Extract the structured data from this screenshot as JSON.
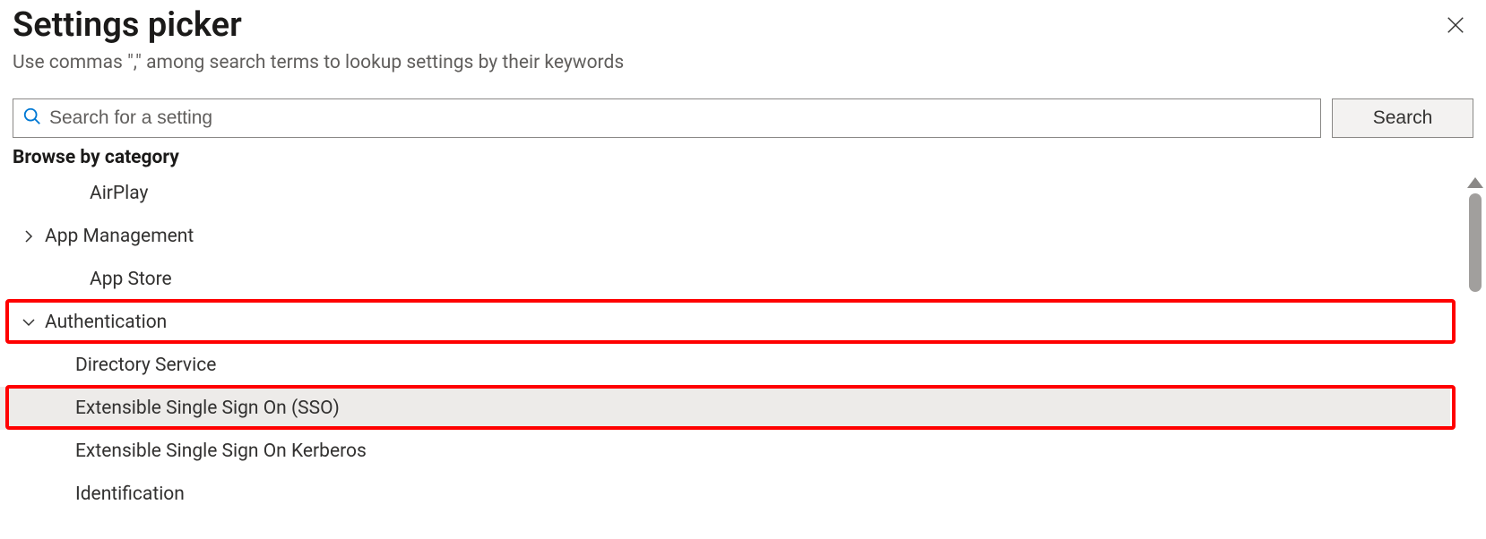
{
  "header": {
    "title": "Settings picker",
    "subtitle": "Use commas \",\" among search terms to lookup settings by their keywords"
  },
  "search": {
    "placeholder": "Search for a setting",
    "value": "",
    "button_label": "Search"
  },
  "browse_label": "Browse by category",
  "categories": [
    {
      "label": "AirPlay",
      "expandable": false,
      "expanded": false,
      "depth": 0,
      "selected": false,
      "highlighted": false
    },
    {
      "label": "App Management",
      "expandable": true,
      "expanded": false,
      "depth": 0,
      "selected": false,
      "highlighted": false
    },
    {
      "label": "App Store",
      "expandable": false,
      "expanded": false,
      "depth": 0,
      "selected": false,
      "highlighted": false
    },
    {
      "label": "Authentication",
      "expandable": true,
      "expanded": true,
      "depth": 0,
      "selected": false,
      "highlighted": true
    },
    {
      "label": "Directory Service",
      "expandable": false,
      "expanded": false,
      "depth": 1,
      "selected": false,
      "highlighted": false
    },
    {
      "label": "Extensible Single Sign On (SSO)",
      "expandable": false,
      "expanded": false,
      "depth": 1,
      "selected": true,
      "highlighted": true
    },
    {
      "label": "Extensible Single Sign On Kerberos",
      "expandable": false,
      "expanded": false,
      "depth": 1,
      "selected": false,
      "highlighted": false
    },
    {
      "label": "Identification",
      "expandable": false,
      "expanded": false,
      "depth": 1,
      "selected": false,
      "highlighted": false
    }
  ],
  "colors": {
    "highlight_border": "#ff0000",
    "selected_bg": "#edebe9",
    "search_icon": "#0078d4"
  }
}
